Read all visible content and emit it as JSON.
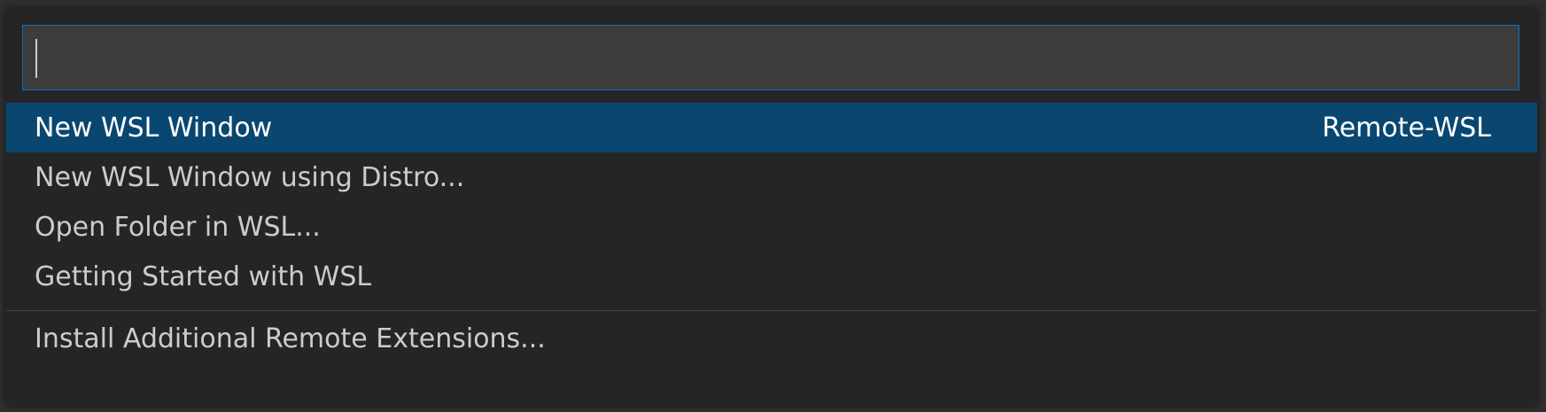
{
  "search": {
    "value": "",
    "placeholder": ""
  },
  "items": [
    {
      "label": "New WSL Window",
      "detail": "Remote-WSL",
      "selected": true
    },
    {
      "label": "New WSL Window using Distro...",
      "detail": ""
    },
    {
      "label": "Open Folder in WSL...",
      "detail": ""
    },
    {
      "label": "Getting Started with WSL",
      "detail": ""
    }
  ],
  "footer_item": {
    "label": "Install Additional Remote Extensions..."
  },
  "colors": {
    "selection": "#094771",
    "focus_border": "#0e70c0",
    "background": "#252526",
    "input_background": "#3c3c3c",
    "text": "#cccccc"
  }
}
